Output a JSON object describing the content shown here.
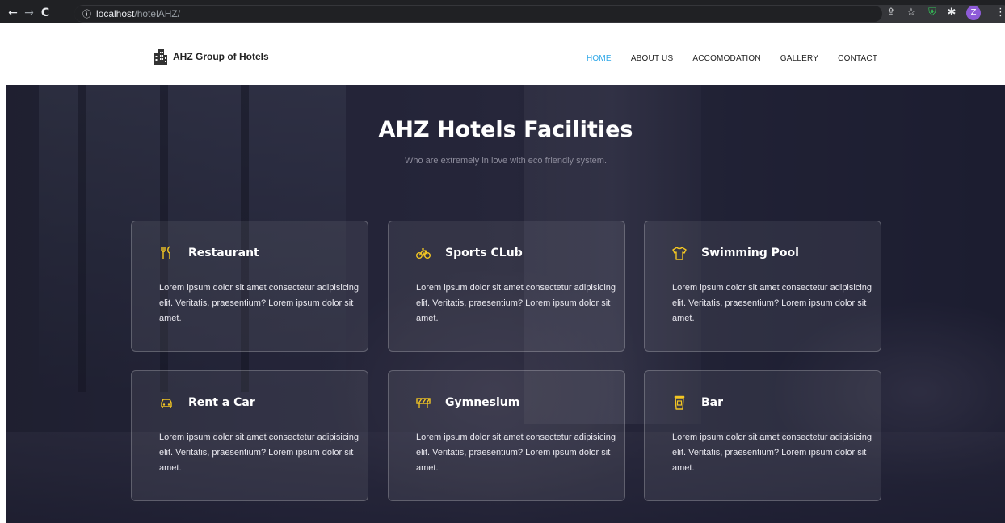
{
  "browser": {
    "url_host": "localhost",
    "url_path": "/hotelAHZ/",
    "avatar_letter": "Z"
  },
  "header": {
    "logo_text": "AHZ Group of Hotels",
    "nav": [
      {
        "label": "HOME",
        "active": true
      },
      {
        "label": "ABOUT US",
        "active": false
      },
      {
        "label": "ACCOMODATION",
        "active": false
      },
      {
        "label": "GALLERY",
        "active": false
      },
      {
        "label": "CONTACT",
        "active": false
      }
    ],
    "active_color": "#2fa8e8"
  },
  "facilities": {
    "title": "AHZ Hotels Facilities",
    "subtitle": "Who are extremely in love with eco friendly system.",
    "icon_color": "#f3c623",
    "cards": [
      {
        "title": "Restaurant",
        "icon": "restaurant-icon",
        "text": "Lorem ipsum dolor sit amet consectetur adipisicing elit. Veritatis, praesentium? Lorem ipsum dolor sit amet."
      },
      {
        "title": "Sports CLub",
        "icon": "bicycle-icon",
        "text": "Lorem ipsum dolor sit amet consectetur adipisicing elit. Veritatis, praesentium? Lorem ipsum dolor sit amet."
      },
      {
        "title": "Swimming Pool",
        "icon": "shirt-icon",
        "text": "Lorem ipsum dolor sit amet consectetur adipisicing elit. Veritatis, praesentium? Lorem ipsum dolor sit amet."
      },
      {
        "title": "Rent a Car",
        "icon": "car-icon",
        "text": "Lorem ipsum dolor sit amet consectetur adipisicing elit. Veritatis, praesentium? Lorem ipsum dolor sit amet."
      },
      {
        "title": "Gymnesium",
        "icon": "barrier-icon",
        "text": "Lorem ipsum dolor sit amet consectetur adipisicing elit. Veritatis, praesentium? Lorem ipsum dolor sit amet."
      },
      {
        "title": "Bar",
        "icon": "cup-icon",
        "text": "Lorem ipsum dolor sit amet consectetur adipisicing elit. Veritatis, praesentium? Lorem ipsum dolor sit amet."
      }
    ]
  }
}
